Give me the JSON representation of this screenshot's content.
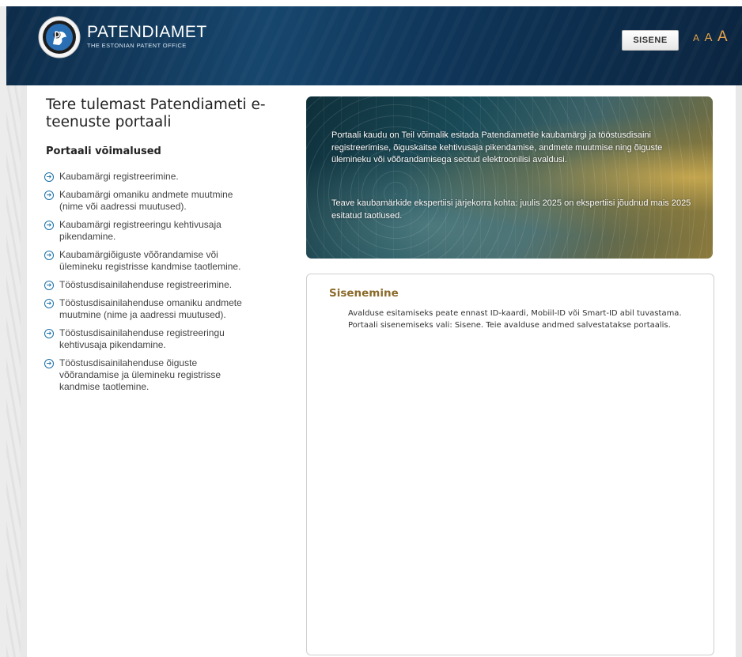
{
  "header": {
    "brand_name": "PATENDIAMET",
    "brand_subtitle": "THE ESTONIAN PATENT OFFICE",
    "login_label": "SISENE",
    "font_size_labels": [
      "A",
      "A",
      "A"
    ],
    "colors": {
      "header_bg": "#123c60",
      "font_size_accent": "#e8a44a"
    }
  },
  "welcome": {
    "title": "Tere tulemast Patendiameti e-teenuste portaali",
    "features_title": "Portaali võimalused",
    "features": [
      "Kaubamärgi registreerimine.",
      "Kaubamärgi omaniku andmete muutmine (nime või aadressi muutused).",
      "Kaubamärgi registreeringu kehtivusaja pikendamine.",
      "Kaubamärgiõiguste võõrandamise või ülemineku registrisse kandmise taotlemine.",
      "Tööstusdisainilahenduse registreerimine.",
      "Tööstusdisainilahenduse omaniku andmete muutmine (nime ja aadressi muutused).",
      "Tööstusdisainilahenduse registreeringu kehtivusaja pikendamine.",
      "Tööstusdisainilahenduse õiguste võõrandamise ja ülemineku registrisse kandmise taotlemine."
    ]
  },
  "banner": {
    "paragraph1": "Portaali kaudu on Teil võimalik esitada Patendiametile kaubamärgi ja tööstusdisaini registreerimise, õiguskaitse kehtivusaja pikendamise, andmete muutmise ning õiguste ülemineku või võõrandamisega seotud elektroonilisi avaldusi.",
    "paragraph2": "Teave kaubamärkide ekspertiisi järjekorra kohta: juulis 2025 on ekspertiisi jõudnud mais 2025 esitatud taotlused."
  },
  "login_panel": {
    "title": "Sisenemine",
    "text": "Avalduse esitamiseks peate ennast ID-kaardi, Mobiil-ID või Smart-ID abil tuvastama. Portaali sisenemiseks vali: Sisene. Teie avalduse andmed salvestatakse portaalis.",
    "title_color": "#8a6a2a"
  },
  "icons": {
    "logo": "patendiamet-seal-icon",
    "bullet": "circle-arrow-right-icon"
  }
}
